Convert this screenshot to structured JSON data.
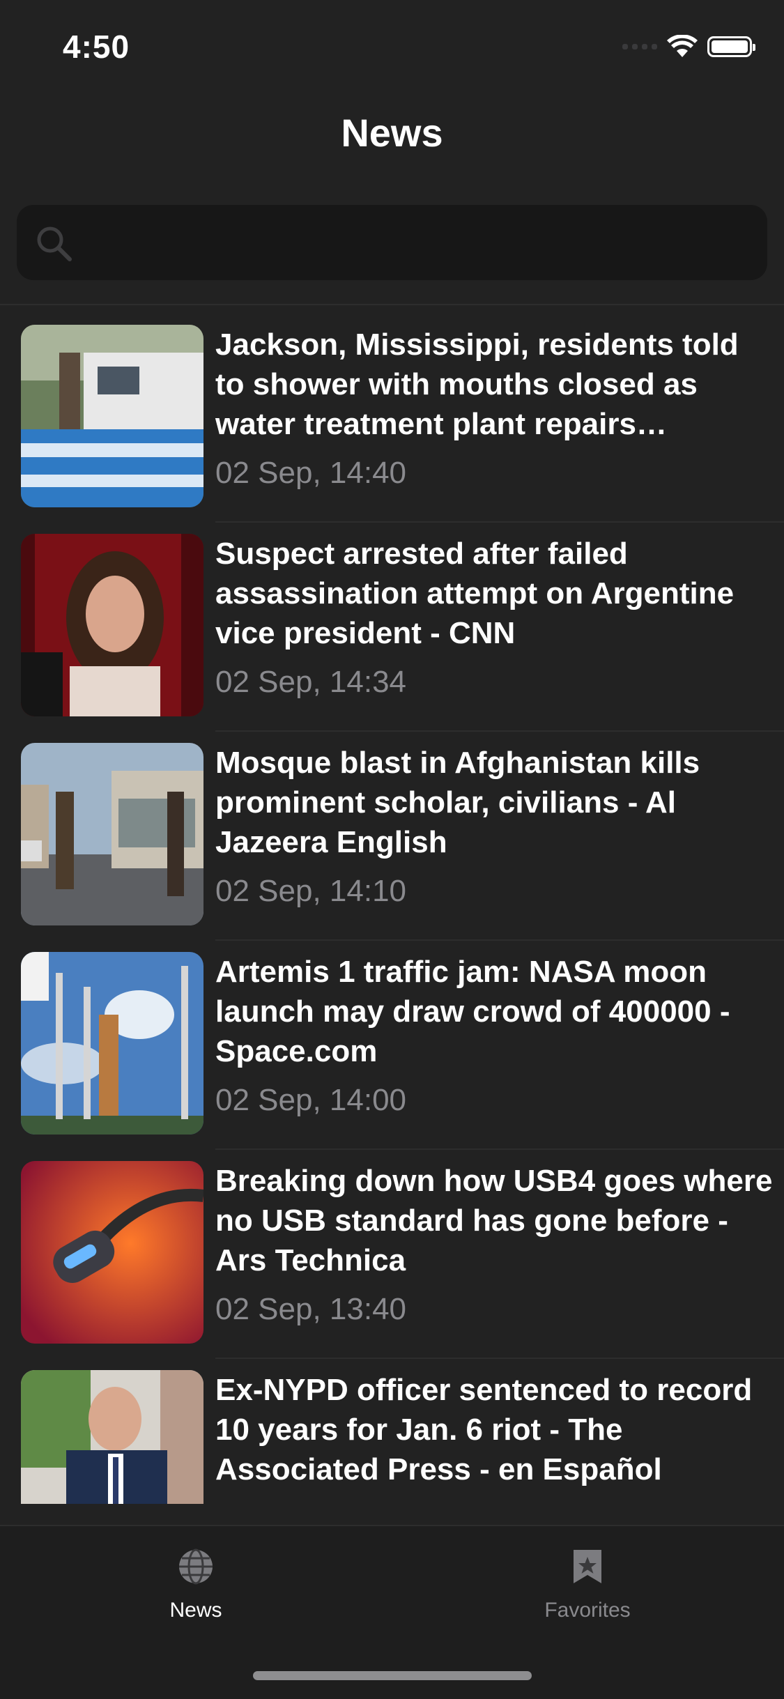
{
  "status_bar": {
    "time": "4:50"
  },
  "nav": {
    "title": "News"
  },
  "search": {
    "placeholder": ""
  },
  "articles": [
    {
      "headline": "Jackson, Mississippi, residents told to shower with mouths closed as water treatment plant repairs…",
      "time": "02 Sep, 14:40"
    },
    {
      "headline": "Suspect arrested after failed assassination attempt on Argentine vice president - CNN",
      "time": "02 Sep, 14:34"
    },
    {
      "headline": "Mosque blast in Afghanistan kills prominent scholar, civilians - Al Jazeera English",
      "time": "02 Sep, 14:10"
    },
    {
      "headline": "Artemis 1 traffic jam: NASA moon launch may draw crowd of 400000 - Space.com",
      "time": "02 Sep, 14:00"
    },
    {
      "headline": "Breaking down how USB4 goes where no USB standard has gone before - Ars Technica",
      "time": "02 Sep, 13:40"
    },
    {
      "headline": "Ex-NYPD officer sentenced to record 10 years for Jan. 6 riot - The Associated Press - en Español",
      "time": ""
    }
  ],
  "tabs": [
    {
      "label": "News",
      "icon": "globe-icon",
      "selected": true
    },
    {
      "label": "Favorites",
      "icon": "bookmark-icon",
      "selected": false
    }
  ],
  "colors": {
    "background": "#222222",
    "search_bg": "#171717",
    "secondary_text": "#8a8a8e",
    "tab_inactive": "#8a8a8e"
  }
}
